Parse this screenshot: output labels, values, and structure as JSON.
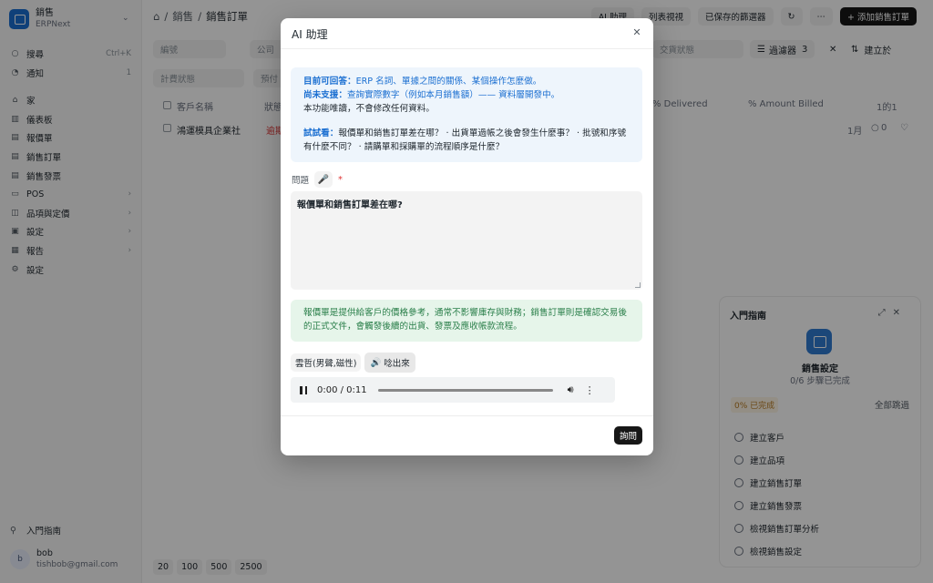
{
  "sidebar": {
    "app_title": "銷售",
    "app_subtitle": "ERPNext",
    "items": [
      {
        "label": "搜尋",
        "icon": "search-icon",
        "glyph": "○",
        "right": "Ctrl+K"
      },
      {
        "label": "通知",
        "icon": "bell-icon",
        "glyph": "◔",
        "right": "1"
      },
      {
        "label": "家",
        "icon": "home-icon",
        "glyph": "⌂",
        "right": ""
      },
      {
        "label": "儀表板",
        "icon": "dashboard-icon",
        "glyph": "▥",
        "right": ""
      },
      {
        "label": "報價單",
        "icon": "quotation-icon",
        "glyph": "▤",
        "right": ""
      },
      {
        "label": "銷售訂單",
        "icon": "sales-order-icon",
        "glyph": "▤",
        "right": ""
      },
      {
        "label": "銷售發票",
        "icon": "invoice-icon",
        "glyph": "▤",
        "right": ""
      },
      {
        "label": "POS",
        "icon": "pos-icon",
        "glyph": "▭",
        "right": "›"
      },
      {
        "label": "品項與定價",
        "icon": "item-icon",
        "glyph": "◫",
        "right": "›"
      },
      {
        "label": "設定",
        "icon": "setup-icon",
        "glyph": "▣",
        "right": "›"
      },
      {
        "label": "報告",
        "icon": "report-icon",
        "glyph": "▦",
        "right": "›"
      },
      {
        "label": "設定",
        "icon": "settings-icon",
        "glyph": "⚙",
        "right": ""
      }
    ],
    "onboarding_label": "入門指南",
    "user_initial": "b",
    "user_name": "bob",
    "user_email": "tishbob@gmail.com"
  },
  "topbar": {
    "crumb_1": "銷售",
    "crumb_2": "銷售訂單",
    "ai_btn": "AI 助理",
    "list_view_btn": "列表視視",
    "saved_filters_btn": "已保存的篩選器",
    "add_btn": "+ 添加銷售訂單"
  },
  "filters": {
    "id_placeholder": "編號",
    "company_placeholder": "公司",
    "status_placeholder": "計費狀態",
    "other_placeholder": "預付",
    "delivery_placeholder": "交貨狀態",
    "filter_btn": "過濾器",
    "filter_count": "3",
    "sort_btn": "建立於"
  },
  "list": {
    "headers": [
      "客戶名稱",
      "狀態",
      "% Delivered",
      "% Amount Billed"
    ],
    "count_label": "1的1",
    "row_customer": "鴻運模具企業社",
    "row_status": "逾期",
    "row_age": "1月",
    "row_comments": "0",
    "page_sizes": [
      "20",
      "100",
      "500",
      "2500"
    ]
  },
  "guide": {
    "title": "入門指南",
    "module_name": "銷售設定",
    "progress_text": "0/6 步驟已完成",
    "percent_text": "0% 已完成",
    "skip_all": "全部跳過",
    "steps": [
      "建立客戶",
      "建立品項",
      "建立銷售訂單",
      "建立銷售發票",
      "檢視銷售訂單分析",
      "檢視銷售設定"
    ]
  },
  "modal": {
    "title": "AI 助理",
    "info": {
      "can_label": "目前可回答",
      "can_text": "ERP 名詞、單據之間的關係、某個操作怎麼做。",
      "cannot_label": "尚未支援",
      "cannot_text": "查詢實際數字（例如本月銷售額）—— 資料層開發中。",
      "readonly_note": "本功能唯讀，不會修改任何資料。",
      "try_label": "試試看",
      "try_text": "報價單和銷售訂單差在哪？ · 出貨單過帳之後會發生什麼事？ · 批號和序號有什麼不同？ · 請購單和採購單的流程順序是什麼？"
    },
    "question_label": "問題",
    "question_value": "報價單和銷售訂單差在哪?",
    "answer_text": "報價單是提供給客戶的價格參考，通常不影響庫存與財務；銷售訂單則是確認交易後的正式文件，會觸發後續的出貨、發票及應收帳款流程。",
    "voice_name": "雲哲(男聲,磁性)",
    "speak_btn": "唸出來",
    "player_time": "0:00 / 0:11",
    "player_progress": 0.0,
    "ask_btn": "詢問"
  }
}
